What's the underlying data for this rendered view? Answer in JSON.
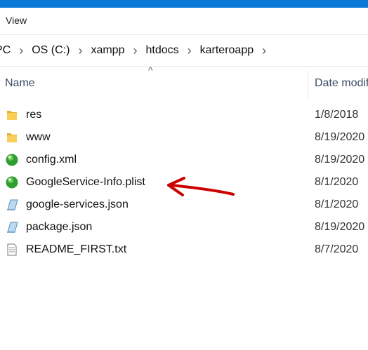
{
  "ribbon": {
    "tab_view": "View"
  },
  "address": {
    "crumbs": [
      "PC",
      "OS (C:)",
      "xampp",
      "htdocs",
      "karteroapp"
    ],
    "separator": "›"
  },
  "columns": {
    "name": "Name",
    "date": "Date modified"
  },
  "files": [
    {
      "name": "res",
      "date": "1/8/2018",
      "icon": "folder-icon"
    },
    {
      "name": "www",
      "date": "8/19/2020",
      "icon": "folder-icon"
    },
    {
      "name": "config.xml",
      "date": "8/19/2020",
      "icon": "green-globe-icon"
    },
    {
      "name": "GoogleService-Info.plist",
      "date": "8/1/2020",
      "icon": "green-globe-icon"
    },
    {
      "name": "google-services.json",
      "date": "8/1/2020",
      "icon": "json-file-icon"
    },
    {
      "name": "package.json",
      "date": "8/19/2020",
      "icon": "json-file-icon"
    },
    {
      "name": "README_FIRST.txt",
      "date": "8/7/2020",
      "icon": "text-file-icon"
    }
  ],
  "colors": {
    "title_bar": "#0a78d6",
    "folder": "#f4c244",
    "annotation_arrow": "#cc0000"
  }
}
